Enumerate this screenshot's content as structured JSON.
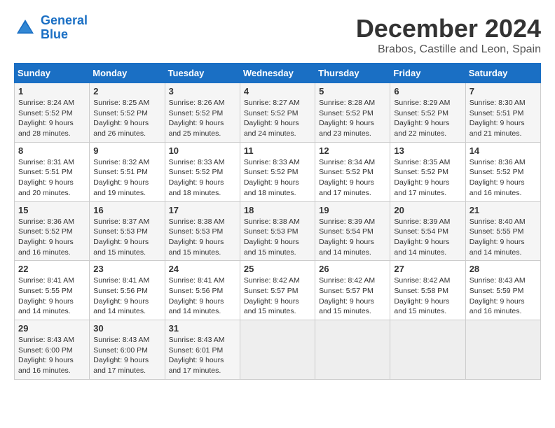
{
  "header": {
    "logo_line1": "General",
    "logo_line2": "Blue",
    "month": "December 2024",
    "location": "Brabos, Castille and Leon, Spain"
  },
  "weekdays": [
    "Sunday",
    "Monday",
    "Tuesday",
    "Wednesday",
    "Thursday",
    "Friday",
    "Saturday"
  ],
  "weeks": [
    [
      {
        "day": "1",
        "info": "Sunrise: 8:24 AM\nSunset: 5:52 PM\nDaylight: 9 hours and 28 minutes."
      },
      {
        "day": "2",
        "info": "Sunrise: 8:25 AM\nSunset: 5:52 PM\nDaylight: 9 hours and 26 minutes."
      },
      {
        "day": "3",
        "info": "Sunrise: 8:26 AM\nSunset: 5:52 PM\nDaylight: 9 hours and 25 minutes."
      },
      {
        "day": "4",
        "info": "Sunrise: 8:27 AM\nSunset: 5:52 PM\nDaylight: 9 hours and 24 minutes."
      },
      {
        "day": "5",
        "info": "Sunrise: 8:28 AM\nSunset: 5:52 PM\nDaylight: 9 hours and 23 minutes."
      },
      {
        "day": "6",
        "info": "Sunrise: 8:29 AM\nSunset: 5:52 PM\nDaylight: 9 hours and 22 minutes."
      },
      {
        "day": "7",
        "info": "Sunrise: 8:30 AM\nSunset: 5:51 PM\nDaylight: 9 hours and 21 minutes."
      }
    ],
    [
      {
        "day": "8",
        "info": "Sunrise: 8:31 AM\nSunset: 5:51 PM\nDaylight: 9 hours and 20 minutes."
      },
      {
        "day": "9",
        "info": "Sunrise: 8:32 AM\nSunset: 5:51 PM\nDaylight: 9 hours and 19 minutes."
      },
      {
        "day": "10",
        "info": "Sunrise: 8:33 AM\nSunset: 5:52 PM\nDaylight: 9 hours and 18 minutes."
      },
      {
        "day": "11",
        "info": "Sunrise: 8:33 AM\nSunset: 5:52 PM\nDaylight: 9 hours and 18 minutes."
      },
      {
        "day": "12",
        "info": "Sunrise: 8:34 AM\nSunset: 5:52 PM\nDaylight: 9 hours and 17 minutes."
      },
      {
        "day": "13",
        "info": "Sunrise: 8:35 AM\nSunset: 5:52 PM\nDaylight: 9 hours and 17 minutes."
      },
      {
        "day": "14",
        "info": "Sunrise: 8:36 AM\nSunset: 5:52 PM\nDaylight: 9 hours and 16 minutes."
      }
    ],
    [
      {
        "day": "15",
        "info": "Sunrise: 8:36 AM\nSunset: 5:52 PM\nDaylight: 9 hours and 16 minutes."
      },
      {
        "day": "16",
        "info": "Sunrise: 8:37 AM\nSunset: 5:53 PM\nDaylight: 9 hours and 15 minutes."
      },
      {
        "day": "17",
        "info": "Sunrise: 8:38 AM\nSunset: 5:53 PM\nDaylight: 9 hours and 15 minutes."
      },
      {
        "day": "18",
        "info": "Sunrise: 8:38 AM\nSunset: 5:53 PM\nDaylight: 9 hours and 15 minutes."
      },
      {
        "day": "19",
        "info": "Sunrise: 8:39 AM\nSunset: 5:54 PM\nDaylight: 9 hours and 14 minutes."
      },
      {
        "day": "20",
        "info": "Sunrise: 8:39 AM\nSunset: 5:54 PM\nDaylight: 9 hours and 14 minutes."
      },
      {
        "day": "21",
        "info": "Sunrise: 8:40 AM\nSunset: 5:55 PM\nDaylight: 9 hours and 14 minutes."
      }
    ],
    [
      {
        "day": "22",
        "info": "Sunrise: 8:41 AM\nSunset: 5:55 PM\nDaylight: 9 hours and 14 minutes."
      },
      {
        "day": "23",
        "info": "Sunrise: 8:41 AM\nSunset: 5:56 PM\nDaylight: 9 hours and 14 minutes."
      },
      {
        "day": "24",
        "info": "Sunrise: 8:41 AM\nSunset: 5:56 PM\nDaylight: 9 hours and 14 minutes."
      },
      {
        "day": "25",
        "info": "Sunrise: 8:42 AM\nSunset: 5:57 PM\nDaylight: 9 hours and 15 minutes."
      },
      {
        "day": "26",
        "info": "Sunrise: 8:42 AM\nSunset: 5:57 PM\nDaylight: 9 hours and 15 minutes."
      },
      {
        "day": "27",
        "info": "Sunrise: 8:42 AM\nSunset: 5:58 PM\nDaylight: 9 hours and 15 minutes."
      },
      {
        "day": "28",
        "info": "Sunrise: 8:43 AM\nSunset: 5:59 PM\nDaylight: 9 hours and 16 minutes."
      }
    ],
    [
      {
        "day": "29",
        "info": "Sunrise: 8:43 AM\nSunset: 6:00 PM\nDaylight: 9 hours and 16 minutes."
      },
      {
        "day": "30",
        "info": "Sunrise: 8:43 AM\nSunset: 6:00 PM\nDaylight: 9 hours and 17 minutes."
      },
      {
        "day": "31",
        "info": "Sunrise: 8:43 AM\nSunset: 6:01 PM\nDaylight: 9 hours and 17 minutes."
      },
      null,
      null,
      null,
      null
    ]
  ]
}
